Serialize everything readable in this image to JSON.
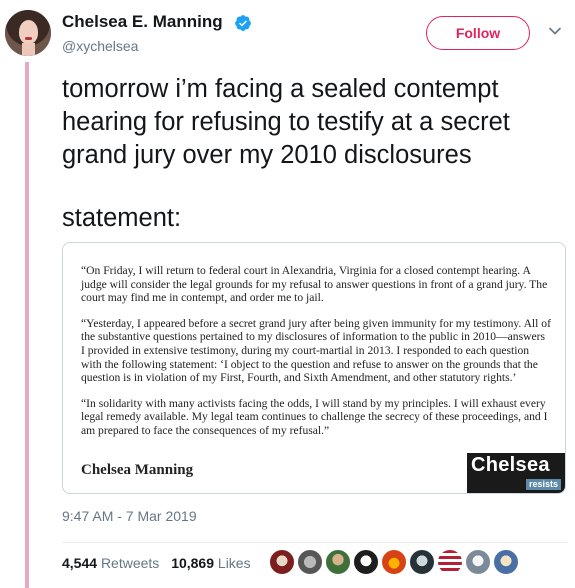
{
  "author": {
    "name": "Chelsea E. Manning",
    "handle": "@xychelsea",
    "verified": true
  },
  "follow_button": {
    "label": "Follow"
  },
  "tweet": {
    "lines": [
      "tomorrow i’m facing a sealed contempt",
      "hearing for refusing to testify at a secret",
      "grand jury over my 2010 disclosures"
    ],
    "statement_label": "statement:"
  },
  "card": {
    "paragraphs": [
      "“On Friday, I will return to federal court in Alexandria, Virginia for a closed contempt hearing. A judge will consider the legal grounds for my refusal to answer questions in front of a grand jury. The court may find me in contempt, and order me to jail.",
      "“Yesterday, I appeared before a secret grand jury after being given immunity for my testimony. All of the substantive questions pertained to my disclosures of information to the public in 2010—answers I provided in extensive testimony, during my court-martial in 2013. I responded to each question with the following statement: ‘I object to the question and refuse to answer on the grounds that the question is in violation of my First, Fourth, and Sixth Amendment, and other statutory rights.’",
      "“In solidarity with many activists facing the odds, I will stand by my principles. I will exhaust every legal remedy available. My legal team continues to challenge the secrecy of these proceedings, and I am prepared to face the consequences of my refusal.”"
    ],
    "signature": "Chelsea Manning",
    "logo_main": "Chelsea",
    "logo_sub": "resists"
  },
  "timestamp": "9:47 AM - 7 Mar 2019",
  "stats": {
    "retweets_count": "4,544",
    "retweets_label": "Retweets",
    "likes_count": "10,869",
    "likes_label": "Likes"
  },
  "colors": {
    "accent": "#e0245e",
    "thread_line": "#e8a9c8",
    "muted_text": "#657786",
    "verified_blue": "#1da1f2"
  },
  "icons": [
    "verified-badge-icon",
    "chevron-down-icon"
  ]
}
